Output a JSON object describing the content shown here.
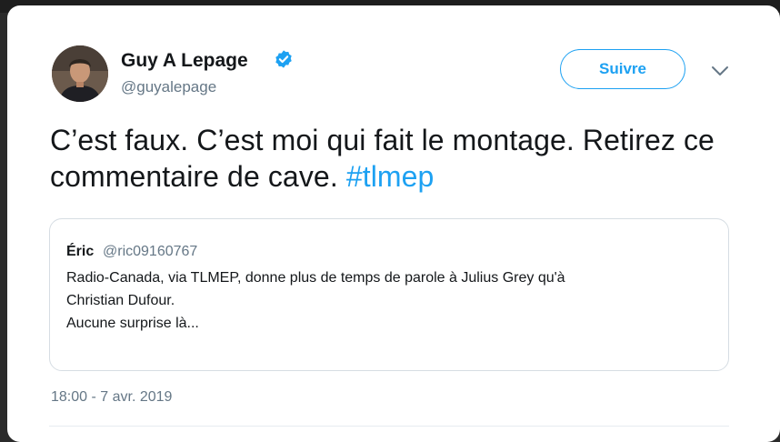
{
  "tweet": {
    "author": {
      "display_name": "Guy A Lepage",
      "handle": "@guyalepage",
      "verified": true
    },
    "follow_label": "Suivre",
    "text": "C’est faux. C’est moi qui fait le montage. Retirez ce commentaire de cave. ",
    "hashtag": "#tlmep",
    "timestamp": "18:00 - 7 avr. 2019"
  },
  "quoted_tweet": {
    "author_name": "Éric",
    "author_handle": "@ric09160767",
    "line1": "Radio-Canada, via TLMEP, donne plus de temps de parole à Julius Grey qu'à",
    "line2": "Christian Dufour.",
    "line3": "Aucune surprise là..."
  },
  "colors": {
    "accent": "#1da1f2",
    "text_primary": "#14171a",
    "text_secondary": "#657786",
    "border": "#d6dde3"
  },
  "icons": {
    "verified": "verified-badge-icon",
    "caret": "chevron-down-icon"
  }
}
